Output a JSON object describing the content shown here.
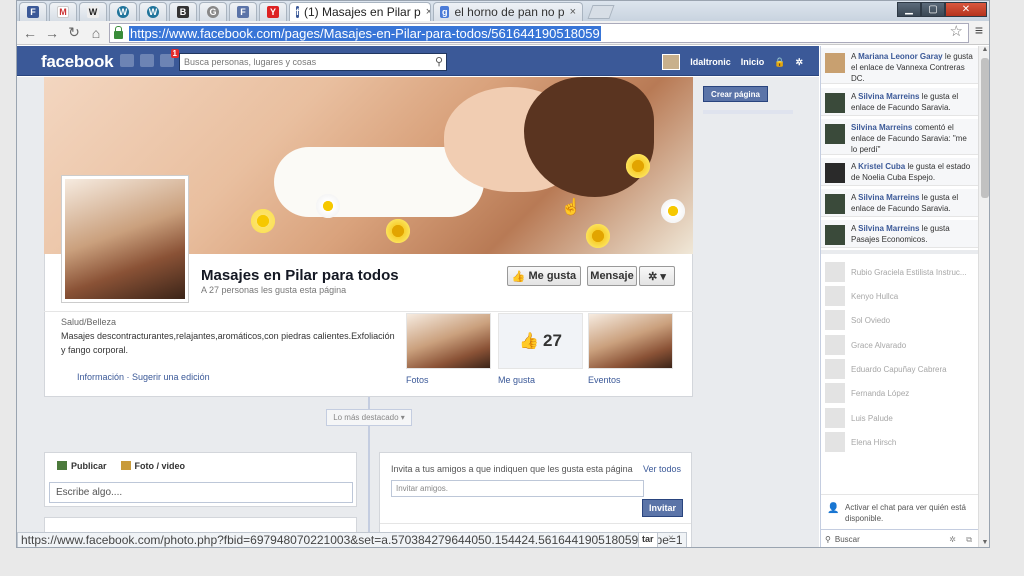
{
  "browser": {
    "tabs": [
      {
        "label": "(1) Masajes en Pilar p",
        "close": "×",
        "active": true
      },
      {
        "label": "el horno de pan no p",
        "close": "×",
        "active": false
      }
    ],
    "pinned_tabs": [
      "F",
      "M",
      "W",
      "W",
      "W",
      "B",
      "G",
      "F",
      "Y"
    ],
    "url": "https://www.facebook.com/pages/Masajes-en-Pilar-para-todos/561644190518059",
    "status_url": "https://www.facebook.com/photo.php?fbid=697948070221003&set=a.570384279644050.154424.561644190518059&type=1"
  },
  "fb": {
    "logo": "facebook",
    "notifications": "1",
    "search_placeholder": "Busca personas, lugares y cosas",
    "user_name": "Idaltronic",
    "home_label": "Inicio"
  },
  "page": {
    "name": "Masajes en Pilar para todos",
    "likes_text": "A 27 personas les gusta esta página",
    "like_button": "Me gusta",
    "message_button": "Mensaje",
    "category": "Salud/Belleza",
    "description": "Masajes descontracturantes,relajantes,aromáticos,con piedras calientes.Exfoliación y fango corporal.",
    "info_link": "Información",
    "suggest_link": "Sugerir una edición",
    "likes_number": "27",
    "apps": [
      "Fotos",
      "Me gusta",
      "Eventos"
    ],
    "highlights": "Lo más destacado",
    "create_page": "Crear página"
  },
  "composer": {
    "tab_publish": "Publicar",
    "tab_photo": "Foto / video",
    "placeholder": "Escribe algo...."
  },
  "invite": {
    "text": "Invita a tus amigos a que indiquen que les gusta esta página",
    "see_all": "Ver todos",
    "placeholder": "Invitar amigos.",
    "button": "Invitar",
    "partial_button": "tar"
  },
  "ticker": [
    {
      "pre": "A ",
      "name": "Mariana Leonor Garay",
      "rest": " le gusta el enlace de Vannexa Contreras DC."
    },
    {
      "pre": "A ",
      "name": "Silvina Marreins",
      "rest": " le gusta el enlace de Facundo Saravia."
    },
    {
      "pre": "",
      "name": "Silvina Marreins",
      "rest": " comentó el enlace de Facundo Saravia: \"me lo perdí\""
    },
    {
      "pre": "A ",
      "name": "Kristel Cuba",
      "rest": " le gusta el estado de Noelia Cuba Espejo."
    },
    {
      "pre": "A ",
      "name": "Silvina Marreins",
      "rest": " le gusta el enlace de Facundo Saravia."
    },
    {
      "pre": "A ",
      "name": "Silvina Marreins",
      "rest": " le gusta Pasajes Economicos."
    }
  ],
  "chat_friends": [
    "Rubio Graciela Estilista Instruc...",
    "Kenyo Hullca",
    "Sol Oviedo",
    "Grace Alvarado",
    "Eduardo Capuñay Cabrera",
    "Fernanda López",
    "Luis Palude",
    "Elena Hirsch"
  ],
  "chat": {
    "enable_text": "Activar el chat para ver quién está disponible.",
    "search": "Buscar"
  },
  "colors": {
    "fb_blue": "#3b5998",
    "accent": "#5b74a8"
  }
}
